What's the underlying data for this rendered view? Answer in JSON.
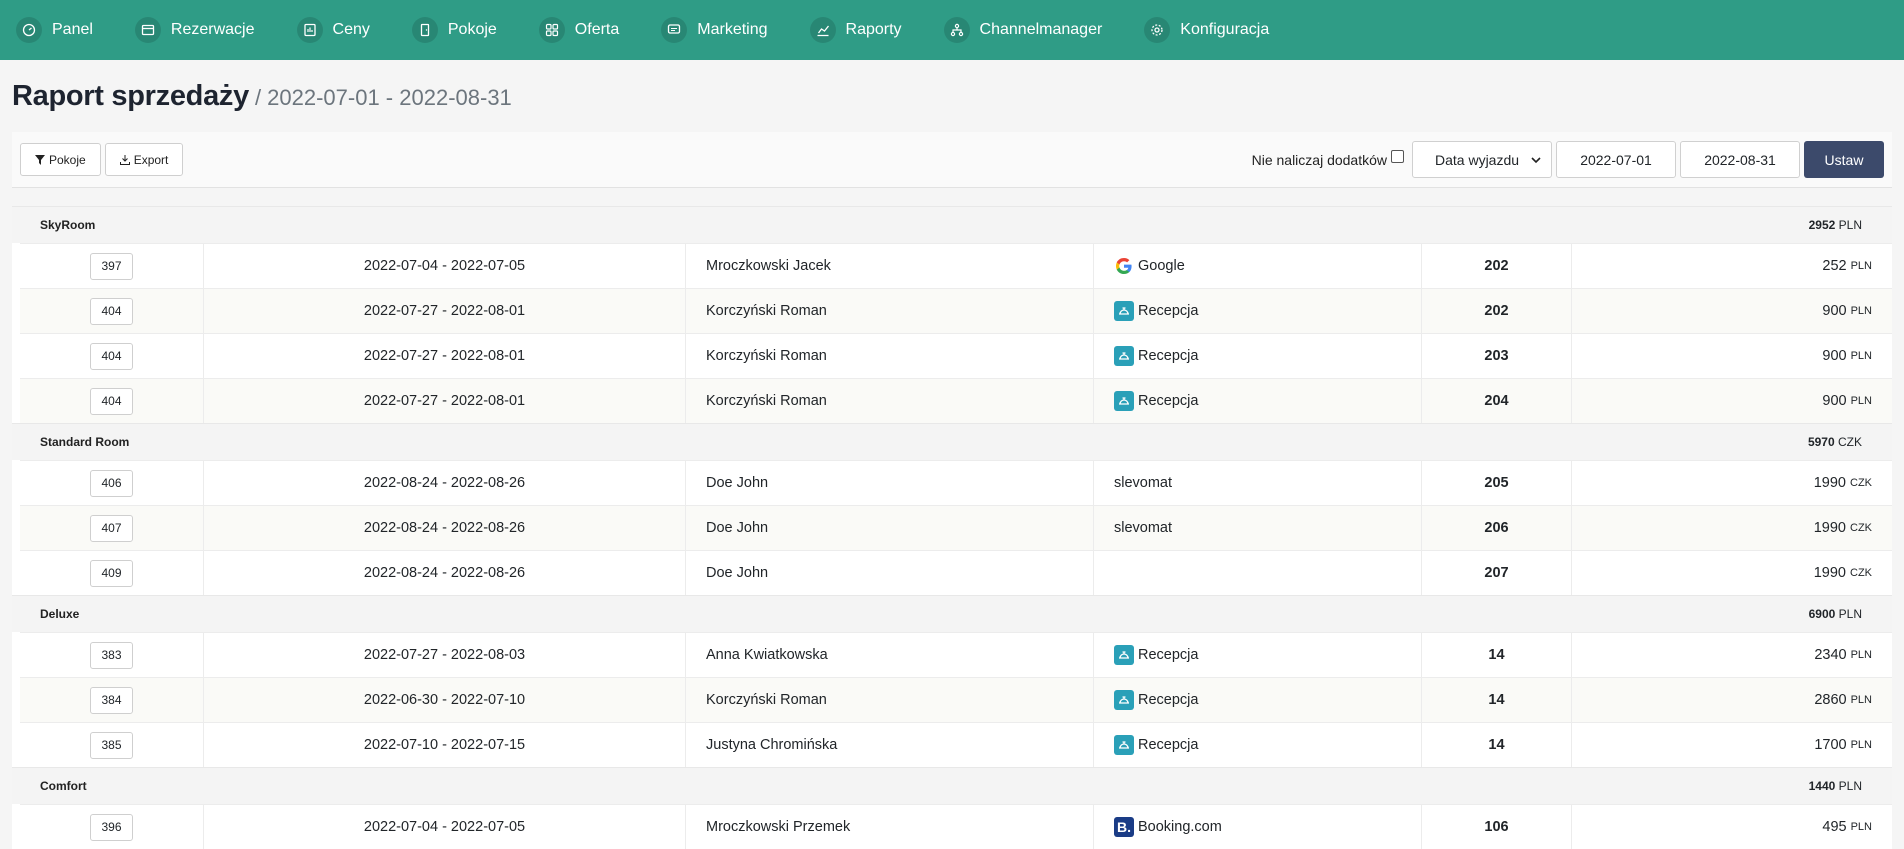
{
  "nav": [
    {
      "label": "Panel",
      "icon": "dashboard-icon"
    },
    {
      "label": "Rezerwacje",
      "icon": "calendar-card-icon"
    },
    {
      "label": "Ceny",
      "icon": "price-icon"
    },
    {
      "label": "Pokoje",
      "icon": "door-icon"
    },
    {
      "label": "Oferta",
      "icon": "grid-icon"
    },
    {
      "label": "Marketing",
      "icon": "chat-icon"
    },
    {
      "label": "Raporty",
      "icon": "chart-icon"
    },
    {
      "label": "Channelmanager",
      "icon": "network-icon"
    },
    {
      "label": "Konfiguracja",
      "icon": "gear-icon"
    }
  ],
  "page": {
    "title": "Raport sprzedaży",
    "subtitle": "/ 2022-07-01 - 2022-08-31"
  },
  "toolbar": {
    "rooms_label": "Pokoje",
    "export_label": "Export",
    "no_extras_label": "Nie naliczaj dodatków",
    "date_type_value": "Data wyjazdu",
    "date_from": "2022-07-01",
    "date_to": "2022-08-31",
    "set_label": "Ustaw"
  },
  "groups": [
    {
      "name": "SkyRoom",
      "total": "2952",
      "currency": "PLN",
      "rows": [
        {
          "id": "397",
          "dates": "2022-07-04 - 2022-07-05",
          "guest": "Mroczkowski Jacek",
          "source": "Google",
          "source_icon": "google-icon",
          "room": "202",
          "amount": "252",
          "currency": "PLN"
        },
        {
          "id": "404",
          "dates": "2022-07-27 - 2022-08-01",
          "guest": "Korczyński Roman",
          "source": "Recepcja",
          "source_icon": "reception-icon",
          "room": "202",
          "amount": "900",
          "currency": "PLN"
        },
        {
          "id": "404",
          "dates": "2022-07-27 - 2022-08-01",
          "guest": "Korczyński Roman",
          "source": "Recepcja",
          "source_icon": "reception-icon",
          "room": "203",
          "amount": "900",
          "currency": "PLN"
        },
        {
          "id": "404",
          "dates": "2022-07-27 - 2022-08-01",
          "guest": "Korczyński Roman",
          "source": "Recepcja",
          "source_icon": "reception-icon",
          "room": "204",
          "amount": "900",
          "currency": "PLN"
        }
      ]
    },
    {
      "name": "Standard Room",
      "total": "5970",
      "currency": "CZK",
      "rows": [
        {
          "id": "406",
          "dates": "2022-08-24 - 2022-08-26",
          "guest": "Doe John",
          "source": "slevomat",
          "source_icon": "",
          "room": "205",
          "amount": "1990",
          "currency": "CZK"
        },
        {
          "id": "407",
          "dates": "2022-08-24 - 2022-08-26",
          "guest": "Doe John",
          "source": "slevomat",
          "source_icon": "",
          "room": "206",
          "amount": "1990",
          "currency": "CZK"
        },
        {
          "id": "409",
          "dates": "2022-08-24 - 2022-08-26",
          "guest": "Doe John",
          "source": "",
          "source_icon": "",
          "room": "207",
          "amount": "1990",
          "currency": "CZK"
        }
      ]
    },
    {
      "name": "Deluxe",
      "total": "6900",
      "currency": "PLN",
      "rows": [
        {
          "id": "383",
          "dates": "2022-07-27 - 2022-08-03",
          "guest": "Anna Kwiatkowska",
          "source": "Recepcja",
          "source_icon": "reception-icon",
          "room": "14",
          "amount": "2340",
          "currency": "PLN"
        },
        {
          "id": "384",
          "dates": "2022-06-30 - 2022-07-10",
          "guest": "Korczyński Roman",
          "source": "Recepcja",
          "source_icon": "reception-icon",
          "room": "14",
          "amount": "2860",
          "currency": "PLN"
        },
        {
          "id": "385",
          "dates": "2022-07-10 - 2022-07-15",
          "guest": "Justyna Chromińska",
          "source": "Recepcja",
          "source_icon": "reception-icon",
          "room": "14",
          "amount": "1700",
          "currency": "PLN"
        }
      ]
    },
    {
      "name": "Comfort",
      "total": "1440",
      "currency": "PLN",
      "rows": [
        {
          "id": "396",
          "dates": "2022-07-04 - 2022-07-05",
          "guest": "Mroczkowski Przemek",
          "source": "Booking.com",
          "source_icon": "booking-icon",
          "room": "106",
          "amount": "495",
          "currency": "PLN"
        }
      ]
    }
  ]
}
